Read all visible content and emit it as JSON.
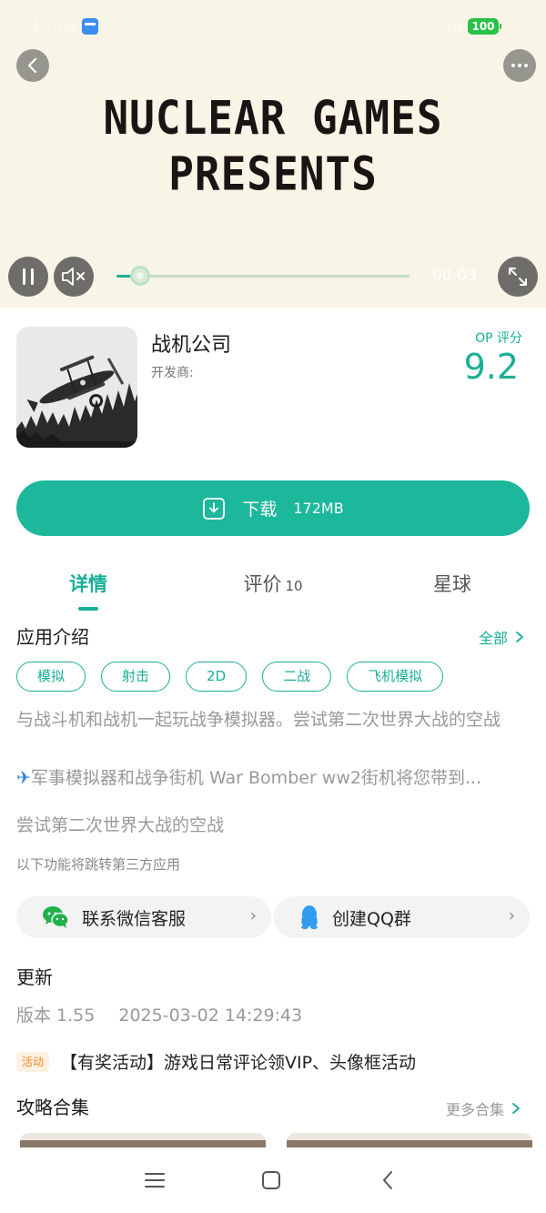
{
  "status_bar": {
    "time": "14:03",
    "right_text": "HD 4G",
    "battery": "100"
  },
  "video": {
    "title_line1": "NUCLEAR GAMES",
    "title_line2": "PRESENTS",
    "time": "00:03",
    "progress_fraction": 0.08
  },
  "app": {
    "name": "战机公司",
    "developer_label": "开发商:",
    "score_label": "OP 评分",
    "score": "9.2"
  },
  "download": {
    "label": "下载",
    "size": "172MB"
  },
  "tabs": [
    {
      "label": "详情",
      "active": true
    },
    {
      "label": "评价",
      "count": "10",
      "active": false
    },
    {
      "label": "星球",
      "active": false
    }
  ],
  "intro": {
    "title": "应用介绍",
    "all_label": "全部",
    "tags": [
      "模拟",
      "射击",
      "2D",
      "二战",
      "飞机模拟"
    ],
    "description": "与战斗机和战机一起玩战争模拟器。尝试第二次世界大战的空战",
    "description_line2": "军事模拟器和战争街机 War Bomber ww2街机将您带到...",
    "description_line3": "尝试第二次世界大战的空战",
    "third_party_note": "以下功能将跳转第三方应用"
  },
  "contacts": [
    {
      "label": "联系微信客服",
      "icon": "wechat-icon"
    },
    {
      "label": "创建QQ群",
      "icon": "qq-icon"
    }
  ],
  "update": {
    "title": "更新",
    "version": "版本 1.55",
    "date": "2025-03-02 14:29:43"
  },
  "activity": {
    "badge": "活动",
    "text": "【有奖活动】游戏日常评论领VIP、头像框活动"
  },
  "guides": {
    "title": "攻略合集",
    "more_label": "更多合集"
  },
  "colors": {
    "accent": "#1db79b",
    "hero_bg": "#f8f5e6",
    "badge_orange": "#f08a24"
  }
}
